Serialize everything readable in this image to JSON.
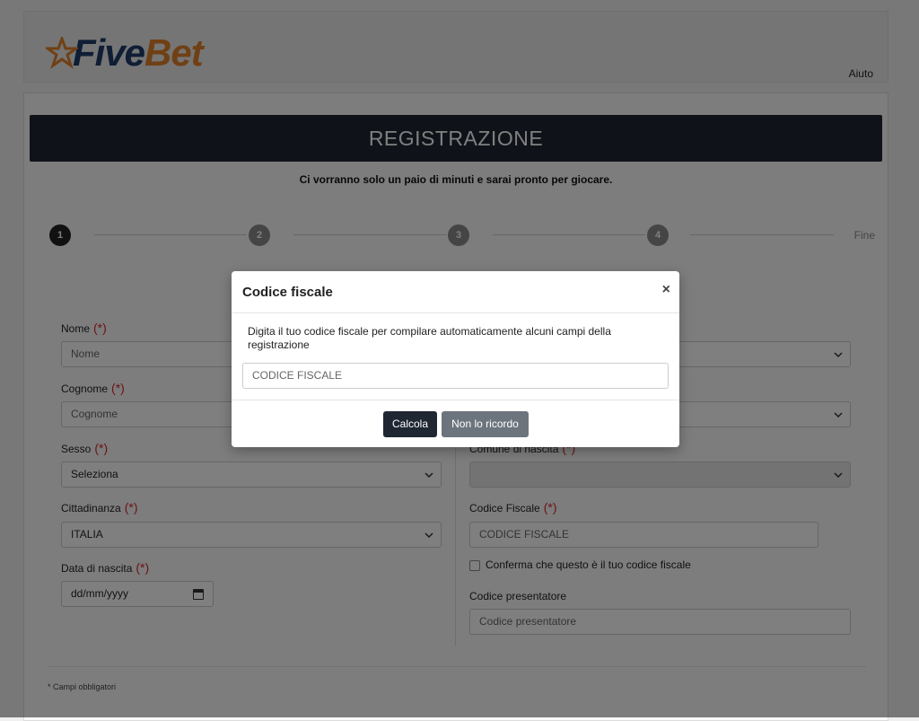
{
  "header": {
    "logo_five": "Five",
    "logo_bet": "Bet",
    "help_link": "Aiuto"
  },
  "registration": {
    "title": "REGISTRAZIONE",
    "subtitle": "Ci vorranno solo un paio di minuti e sarai pronto per giocare.",
    "steps": [
      "1",
      "2",
      "3",
      "4"
    ],
    "steps_end": "Fine",
    "required_mark": "(*)",
    "fields": {
      "nome_label": "Nome",
      "nome_placeholder": "Nome",
      "cognome_label": "Cognome",
      "cognome_placeholder": "Cognome",
      "sesso_label": "Sesso",
      "sesso_value": "Seleziona",
      "cittadinanza_label": "Cittadinanza",
      "cittadinanza_value": "ITALIA",
      "nascita_label": "Data di nascita",
      "nascita_placeholder": "dd/mm/yyyy",
      "comune_label": "Comune di nascita",
      "codice_fiscale_label": "Codice Fiscale",
      "codice_fiscale_placeholder": "CODICE FISCALE",
      "conferma_label": "Conferma che questo è il tuo codice fiscale",
      "presentatore_label": "Codice presentatore",
      "presentatore_placeholder": "Codice presentatore"
    },
    "footnote": "* Campi obbligatori"
  },
  "modal": {
    "title": "Codice fiscale",
    "close": "×",
    "description": "Digita il tuo codice fiscale per compilare automaticamente alcuni campi della registrazione",
    "input_placeholder": "CODICE FISCALE",
    "calcola": "Calcola",
    "non_ricordo": "Non lo ricordo"
  },
  "colors": {
    "brand_dark": "#1f2733",
    "brand_orange": "#e0812a",
    "brand_blue": "#1e3a6b",
    "required_red": "#d9262b"
  }
}
